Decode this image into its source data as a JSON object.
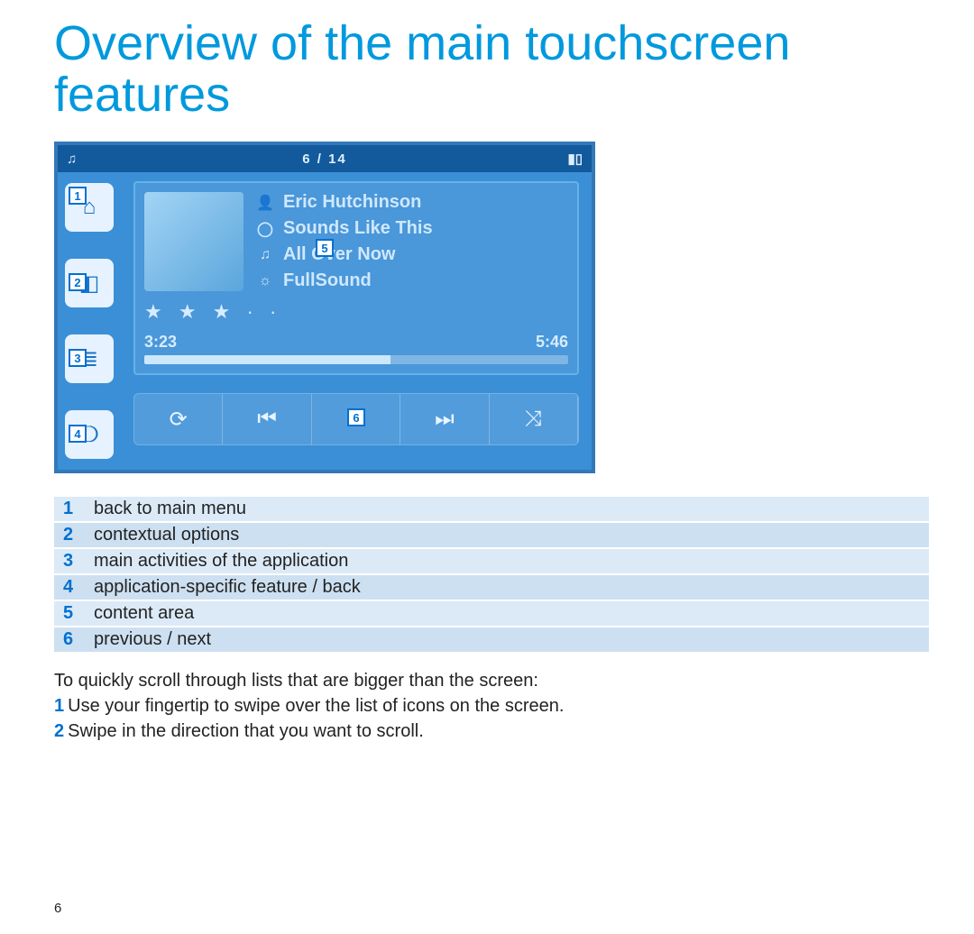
{
  "title": "Overview of the main touchscreen features",
  "device": {
    "statusbar": {
      "track_index": "6 / 14"
    },
    "content": {
      "artist": "Eric Hutchinson",
      "album": "Sounds Like This",
      "track": "All Over Now",
      "sound_mode": "FullSound",
      "rating_stars": "★ ★ ★ · ·",
      "elapsed": "3:23",
      "total": "5:46"
    },
    "callouts": {
      "1": "1",
      "2": "2",
      "3": "3",
      "4": "4",
      "5": "5",
      "6": "6"
    }
  },
  "legend": [
    {
      "num": "1",
      "text": "back to main menu"
    },
    {
      "num": "2",
      "text": "contextual options"
    },
    {
      "num": "3",
      "text": "main activities of the application"
    },
    {
      "num": "4",
      "text": "application-specific feature / back"
    },
    {
      "num": "5",
      "text": "content area"
    },
    {
      "num": "6",
      "text": "previous / next"
    }
  ],
  "instructions": {
    "lead": "To quickly scroll through lists that are bigger than the screen:",
    "steps": [
      {
        "num": "1",
        "text": "Use your fingertip to swipe over the list of icons on the screen."
      },
      {
        "num": "2",
        "text": "Swipe in the direction that you want to scroll."
      }
    ]
  },
  "page_number": "6"
}
